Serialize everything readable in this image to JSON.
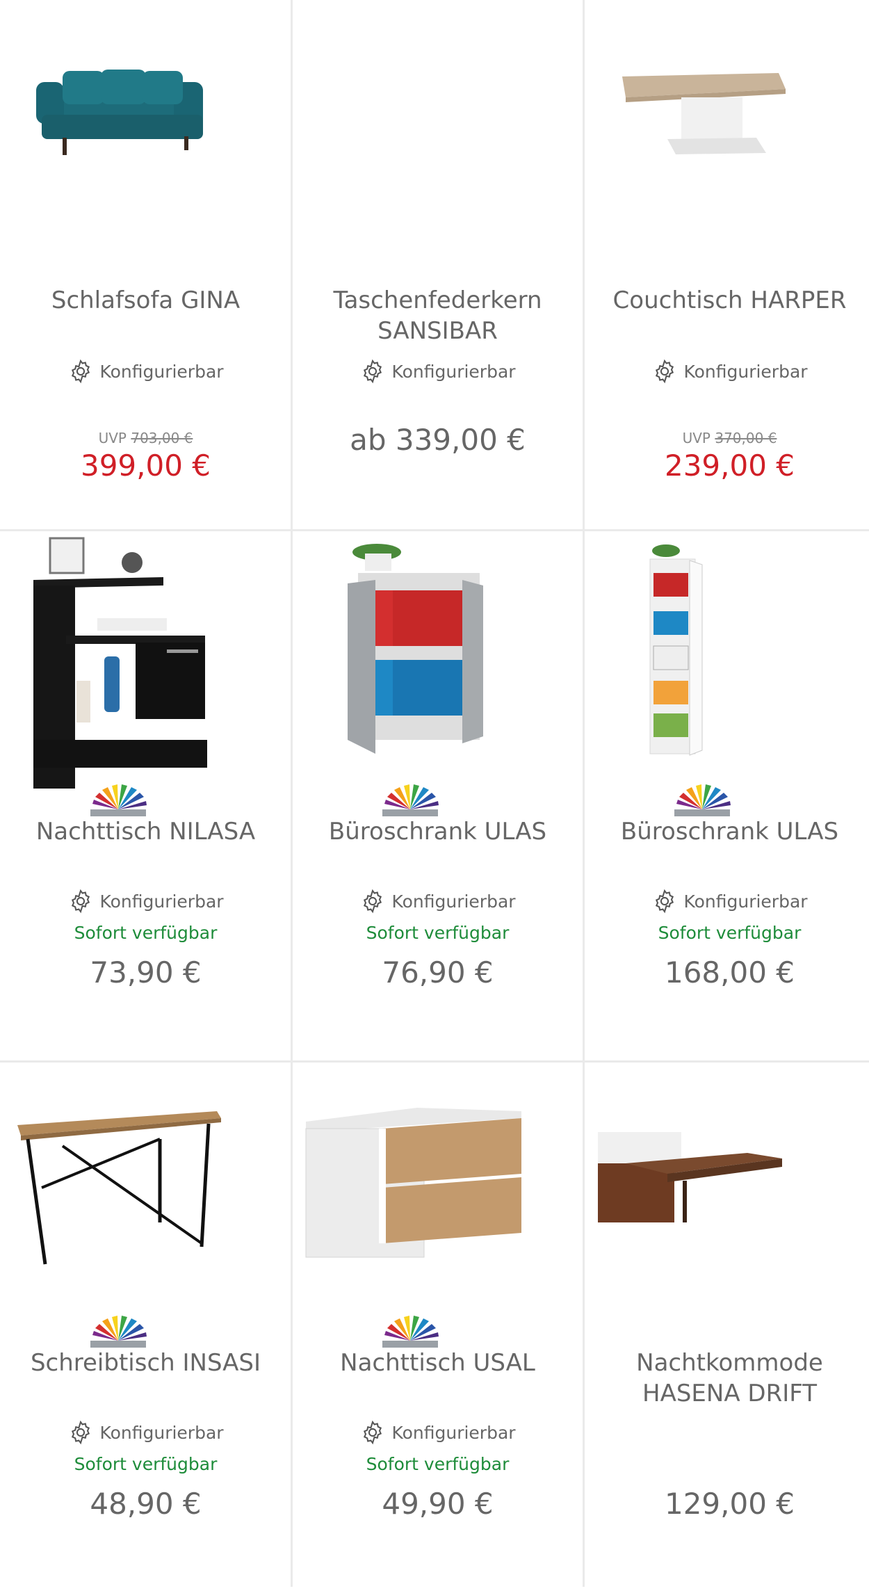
{
  "products": [
    {
      "title": "Schlafsofa GINA",
      "config": "Konfigurierbar",
      "uvp_label": "UVP",
      "uvp_price": "703,00 €",
      "price": "399,00 €",
      "sale": true,
      "availability": "",
      "swatch": false,
      "image": "teal-sofa-bed"
    },
    {
      "title": "Taschenfederkern SANSIBAR",
      "config": "Konfigurierbar",
      "uvp_label": "",
      "uvp_price": "",
      "price": "ab 339,00 €",
      "sale": false,
      "availability": "",
      "swatch": false,
      "image": "mattress"
    },
    {
      "title": "Couchtisch HARPER",
      "config": "Konfigurierbar",
      "uvp_label": "UVP",
      "uvp_price": "370,00 €",
      "price": "239,00 €",
      "sale": true,
      "availability": "",
      "swatch": false,
      "image": "coffee-table"
    },
    {
      "title": "Nachttisch NILASA",
      "config": "Konfigurierbar",
      "uvp_label": "",
      "uvp_price": "",
      "price": "73,90 €",
      "sale": false,
      "availability": "Sofort verfügbar",
      "swatch": true,
      "image": "black-nightstand"
    },
    {
      "title": "Büroschrank ULAS",
      "config": "Konfigurierbar",
      "uvp_label": "",
      "uvp_price": "",
      "price": "76,90 €",
      "sale": false,
      "availability": "Sofort verfügbar",
      "swatch": true,
      "image": "grey-office-cabinet"
    },
    {
      "title": "Büroschrank ULAS",
      "config": "Konfigurierbar",
      "uvp_label": "",
      "uvp_price": "",
      "price": "168,00 €",
      "sale": false,
      "availability": "Sofort verfügbar",
      "swatch": true,
      "image": "tall-white-cabinet"
    },
    {
      "title": "Schreibtisch INSASI",
      "config": "Konfigurierbar",
      "uvp_label": "",
      "uvp_price": "",
      "price": "48,90 €",
      "sale": false,
      "availability": "Sofort verfügbar",
      "swatch": true,
      "image": "desk"
    },
    {
      "title": "Nachttisch USAL",
      "config": "Konfigurierbar",
      "uvp_label": "",
      "uvp_price": "",
      "price": "49,90 €",
      "sale": false,
      "availability": "Sofort verfügbar",
      "swatch": true,
      "image": "wall-nightstand"
    },
    {
      "title": "Nachtkommode HASENA DRIFT",
      "config": "",
      "uvp_label": "",
      "uvp_price": "",
      "price": "129,00 €",
      "sale": false,
      "availability": "",
      "swatch": false,
      "image": "bed-side-shelf"
    }
  ],
  "colors": {
    "sale_price": "#d01f27",
    "availability": "#1e8c3a",
    "text": "#666666",
    "divider": "#eaeaea"
  }
}
